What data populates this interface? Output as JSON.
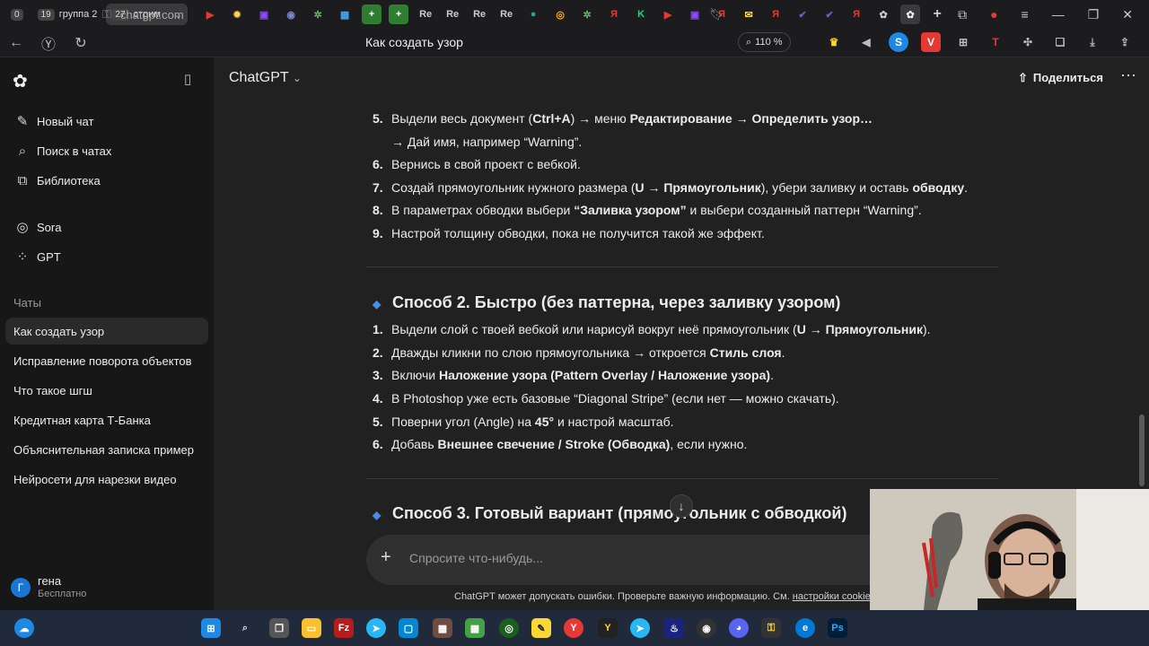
{
  "browser": {
    "tab_groups": [
      {
        "count": "0",
        "label": ""
      },
      {
        "count": "19",
        "label": "группа 2"
      },
      {
        "count": "27",
        "label": "стрим"
      }
    ],
    "url": "chatgpt.com",
    "page_title": "Как создать узор",
    "zoom": "110 %"
  },
  "sidebar": {
    "new_chat": "Новый чат",
    "search": "Поиск в чатах",
    "library": "Библиотека",
    "sora": "Sora",
    "gpt": "GPT",
    "chats_label": "Чаты",
    "chats": [
      "Как создать узор",
      "Исправление поворота объектов",
      "Что такое шгш",
      "Кредитная карта Т-Банка",
      "Объяснительная записка пример",
      "Нейросети для нарезки видео"
    ],
    "user": {
      "initial": "Г",
      "name": "гена",
      "plan": "Бесплатно"
    }
  },
  "header": {
    "model": "ChatGPT",
    "share": "Поделиться"
  },
  "content": {
    "list1": [
      {
        "n": "5.",
        "html": "Выдели весь документ (<b>Ctrl+A</b>) → меню <b>Редактирование → Определить узор…</b>"
      },
      {
        "n": "",
        "html": "→ Дай имя, например “Warning”."
      },
      {
        "n": "6.",
        "html": "Вернись в свой проект с вебкой."
      },
      {
        "n": "7.",
        "html": "Создай прямоугольник нужного размера (<b>U → Прямоугольник</b>), убери заливку и оставь <b>обводку</b>."
      },
      {
        "n": "8.",
        "html": "В параметрах обводки выбери <b>“Заливка узором”</b> и выбери созданный паттерн “Warning”."
      },
      {
        "n": "9.",
        "html": "Настрой толщину обводки, пока не получится такой же эффект."
      }
    ],
    "heading2": "Способ 2. Быстро (без паттерна, через заливку узором)",
    "list2": [
      {
        "n": "1.",
        "html": "Выдели слой с твоей вебкой или нарисуй вокруг неё прямоугольник (<b>U → Прямоугольник</b>)."
      },
      {
        "n": "2.",
        "html": "Дважды кликни по слою прямоугольника → откроется <b>Стиль слоя</b>."
      },
      {
        "n": "3.",
        "html": "Включи <b>Наложение узора (Pattern Overlay / Наложение узора)</b>."
      },
      {
        "n": "4.",
        "html": "В Photoshop уже есть базовые “Diagonal Stripe” (если нет — можно скачать)."
      },
      {
        "n": "5.",
        "html": "Поверни угол (Angle) на <b>45°</b> и настрой масштаб."
      },
      {
        "n": "6.",
        "html": "Добавь <b>Внешнее свечение / Stroke (Обводка)</b>, если нужно."
      }
    ],
    "heading3": "Способ 3. Готовый вариант (прямоугольник с обводкой)"
  },
  "composer": {
    "placeholder": "Спросите что-нибудь..."
  },
  "disclaimer": {
    "text": "ChatGPT может допускать ошибки. Проверьте важную информацию. См. ",
    "link": "настройки cookie"
  },
  "colors": {
    "accent": "#4a8de8",
    "bg": "#212121",
    "sidebar": "#171717"
  }
}
